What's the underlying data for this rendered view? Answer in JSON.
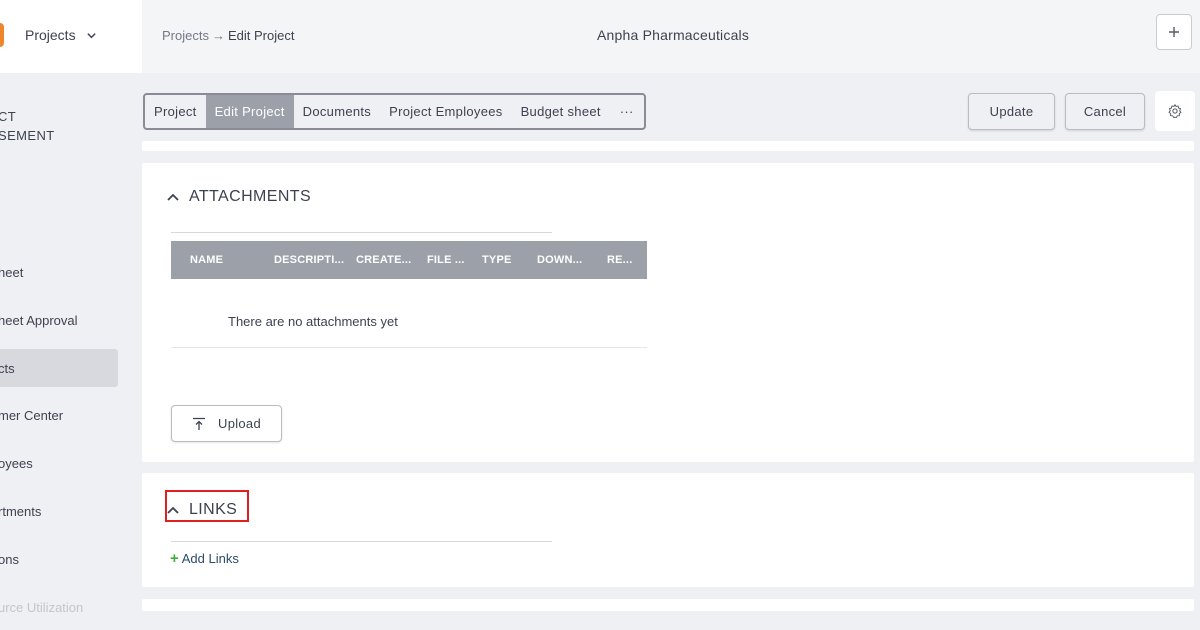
{
  "sidebar": {
    "app_label": "Projects",
    "section_line1": "CT",
    "section_line2": "SEMENT",
    "items": [
      {
        "label": "heet"
      },
      {
        "label": "heet Approval"
      },
      {
        "label": "cts"
      },
      {
        "label": "mer Center"
      },
      {
        "label": "oyees"
      },
      {
        "label": "rtments"
      },
      {
        "label": "ons"
      },
      {
        "label": "urce Utilization"
      }
    ],
    "active_index": 2
  },
  "header": {
    "breadcrumb_root": "Projects",
    "breadcrumb_sep": "→",
    "breadcrumb_current": "Edit Project",
    "company": "Anpha Pharmaceuticals"
  },
  "tabs": [
    {
      "label": "Project"
    },
    {
      "label": "Edit Project"
    },
    {
      "label": "Documents"
    },
    {
      "label": "Project Employees"
    },
    {
      "label": "Budget sheet"
    },
    {
      "label": "···"
    }
  ],
  "active_tab": 1,
  "actions": {
    "update_label": "Update",
    "cancel_label": "Cancel"
  },
  "attachments": {
    "title": "ATTACHMENTS",
    "columns": [
      "NAME",
      "DESCRIPTI...",
      "CREATE...",
      "FILE ...",
      "TYPE",
      "DOWN...",
      "RE..."
    ],
    "empty_message": "There are no attachments yet",
    "upload_label": "Upload"
  },
  "links": {
    "title": "LINKS",
    "add_label": "Add Links"
  },
  "colors": {
    "accent_orange": "#f0862b",
    "highlight_red": "#e02020",
    "add_green": "#3fae3f",
    "table_header": "#9ca0a9"
  }
}
